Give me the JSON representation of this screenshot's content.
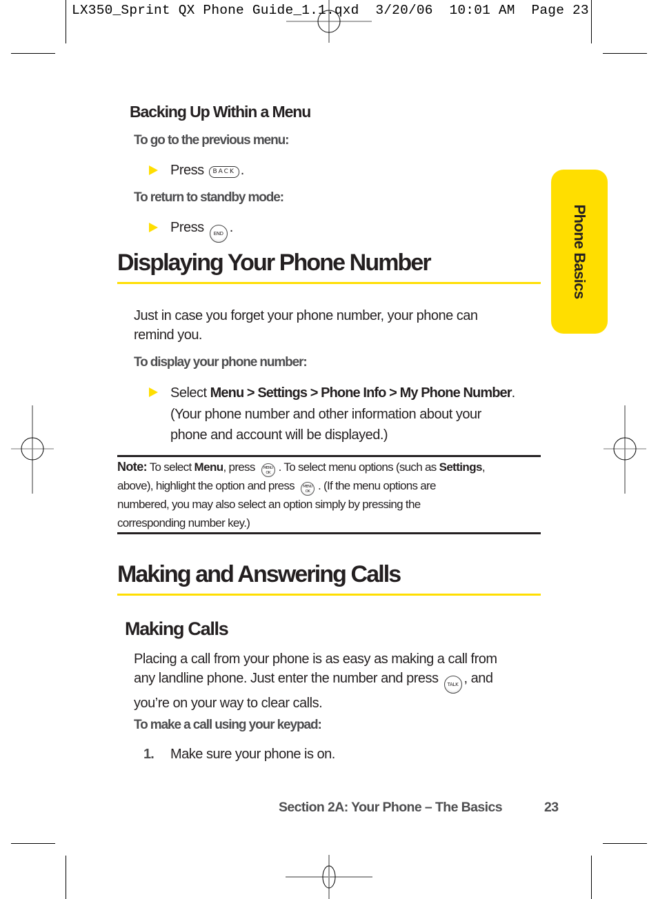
{
  "slug": "LX350_Sprint QX Phone Guide_1.1.qxd  3/20/06  10:01 AM  Page 23",
  "side_tab": {
    "label": "Phone Basics",
    "color": "#ffde00"
  },
  "accent_color": "#ffde00",
  "backing_up": {
    "heading": "Backing Up Within a Menu",
    "previous_menu": {
      "label": "To go to the previous menu:",
      "step_prefix": "Press",
      "key": "BACK",
      "step_suffix": "."
    },
    "standby": {
      "label": "To return to standby mode:",
      "step_prefix": "Press",
      "key": "END",
      "step_suffix": "."
    }
  },
  "display_number": {
    "heading": "Displaying Your Phone Number",
    "intro_line1": "Just in case you forget your phone number, your phone can",
    "intro_line2": "remind you.",
    "instruction_label": "To display your phone number:",
    "step": {
      "prefix": "Select ",
      "path": "Menu > Settings > Phone Info > My Phone Number",
      "suffix": ".",
      "line2": "(Your phone number and other information about your",
      "line3": "phone and account will be displayed.)"
    }
  },
  "note": {
    "label": "Note:",
    "t1": " To select ",
    "b1": "Menu",
    "t2": ", press ",
    "t3": ". To select menu options (such as ",
    "b2": "Settings",
    "t4": ",",
    "t5": "above), highlight the option and press ",
    "t6": ". (If the menu options are",
    "t7": "numbered, you may also select an option simply by pressing the",
    "t8": "corresponding number key.)",
    "key_top": "MENU",
    "key_bottom": "OK"
  },
  "calls": {
    "heading": "Making and Answering Calls",
    "subheading": "Making Calls",
    "para_line1": "Placing a call from your phone is as easy as making a call from",
    "para_line2_a": "any landline phone. Just enter the number and press",
    "para_key": "TALK",
    "para_line2_b": ", and",
    "para_line3": "you’re on your way to clear calls.",
    "instruction_label": "To make a call using your keypad:",
    "steps": [
      {
        "num": "1.",
        "text": "Make sure your phone is on."
      }
    ]
  },
  "footer": {
    "section": "Section 2A: Your Phone – The Basics",
    "page": "23"
  }
}
